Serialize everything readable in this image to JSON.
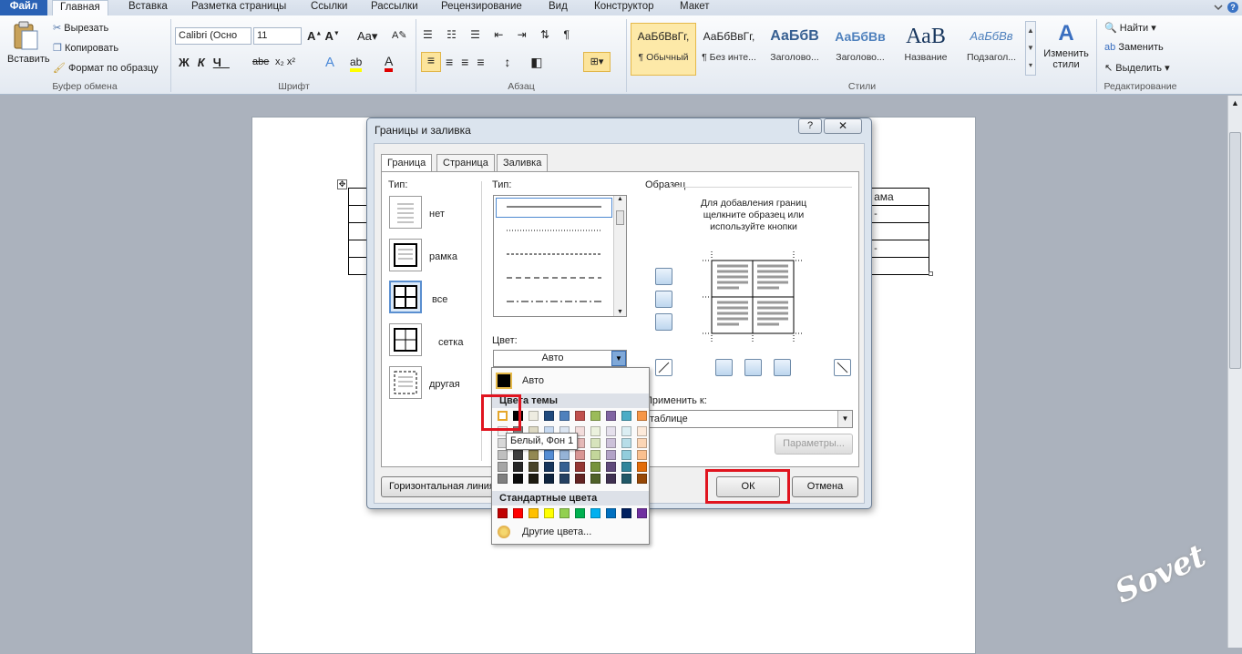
{
  "ribbon_tabs": [
    "Файл",
    "Главная",
    "Вставка",
    "Разметка страницы",
    "Ссылки",
    "Рассылки",
    "Рецензирование",
    "Вид",
    "Конструктор",
    "Макет"
  ],
  "clipboard": {
    "paste": "Вставить",
    "cut": "Вырезать",
    "copy": "Копировать",
    "format_painter": "Формат по образцу",
    "group": "Буфер обмена"
  },
  "font": {
    "name": "Calibri (Осно",
    "size": "11",
    "group": "Шрифт"
  },
  "paragraph": {
    "group": "Абзац"
  },
  "styles": {
    "items": [
      {
        "preview": "АаБбВвГг,",
        "name": "¶ Обычный"
      },
      {
        "preview": "АаБбВвГг,",
        "name": "¶ Без инте..."
      },
      {
        "preview": "АаБбВ",
        "name": "Заголово..."
      },
      {
        "preview": "АаБбВв",
        "name": "Заголово..."
      },
      {
        "preview": "АаВ",
        "name": "Название"
      },
      {
        "preview": "АаБбВв",
        "name": "Подзагол..."
      }
    ],
    "change": "Изменить стили",
    "group": "Стили"
  },
  "editing": {
    "find": "Найти",
    "replace": "Заменить",
    "select": "Выделить",
    "group": "Редактирование"
  },
  "doc_table": {
    "cells": [
      "ама",
      "-",
      "-"
    ]
  },
  "dialog": {
    "title": "Границы и заливка",
    "help": "?",
    "tabs": [
      "Граница",
      "Страница",
      "Заливка"
    ],
    "type_label": "Тип:",
    "presets": [
      "нет",
      "рамка",
      "все",
      "сетка",
      "другая"
    ],
    "style_label": "Тип:",
    "color_label": "Цвет:",
    "color_value": "Авто",
    "preview_label": "Образец",
    "preview_hint": "Для добавления границ щелкните образец или используйте кнопки",
    "apply_label": "Применить к:",
    "apply_value": "таблице",
    "params_button": "Параметры...",
    "hline_button": "Горизонтальная линия...",
    "ok": "ОК",
    "cancel": "Отмена"
  },
  "color_popup": {
    "auto": "Авто",
    "theme_title": "Цвета темы",
    "standard_title": "Стандартные цвета",
    "more": "Другие цвета...",
    "tooltip": "Белый, Фон 1",
    "theme_top": [
      "#ffffff",
      "#000000",
      "#eeece1",
      "#1f497d",
      "#4f81bd",
      "#c0504d",
      "#9bbb59",
      "#8064a2",
      "#4bacc6",
      "#f79646"
    ],
    "theme_shades": [
      [
        "#f2f2f2",
        "#7f7f7f",
        "#ddd9c3",
        "#c6d9f0",
        "#dbe5f1",
        "#f2dcdb",
        "#ebf1dd",
        "#e5e0ec",
        "#dbeef3",
        "#fdeada"
      ],
      [
        "#d8d8d8",
        "#595959",
        "#c4bd97",
        "#8db3e2",
        "#b8cce4",
        "#e5b9b7",
        "#d7e3bc",
        "#ccc1d9",
        "#b7dde8",
        "#fbd5b5"
      ],
      [
        "#bfbfbf",
        "#3f3f3f",
        "#938953",
        "#548dd4",
        "#95b3d7",
        "#d99694",
        "#c3d69b",
        "#b2a2c7",
        "#92cddc",
        "#fac08f"
      ],
      [
        "#a5a5a5",
        "#262626",
        "#494429",
        "#17365d",
        "#366092",
        "#953734",
        "#76923c",
        "#5f497a",
        "#31859b",
        "#e36c09"
      ],
      [
        "#7f7f7f",
        "#0c0c0c",
        "#1d1b10",
        "#0f243e",
        "#244061",
        "#632423",
        "#4f6128",
        "#3f3151",
        "#205867",
        "#974806"
      ]
    ],
    "standard": [
      "#c00000",
      "#ff0000",
      "#ffc000",
      "#ffff00",
      "#92d050",
      "#00b050",
      "#00b0f0",
      "#0070c0",
      "#002060",
      "#7030a0"
    ]
  },
  "watermark": "Sovet"
}
